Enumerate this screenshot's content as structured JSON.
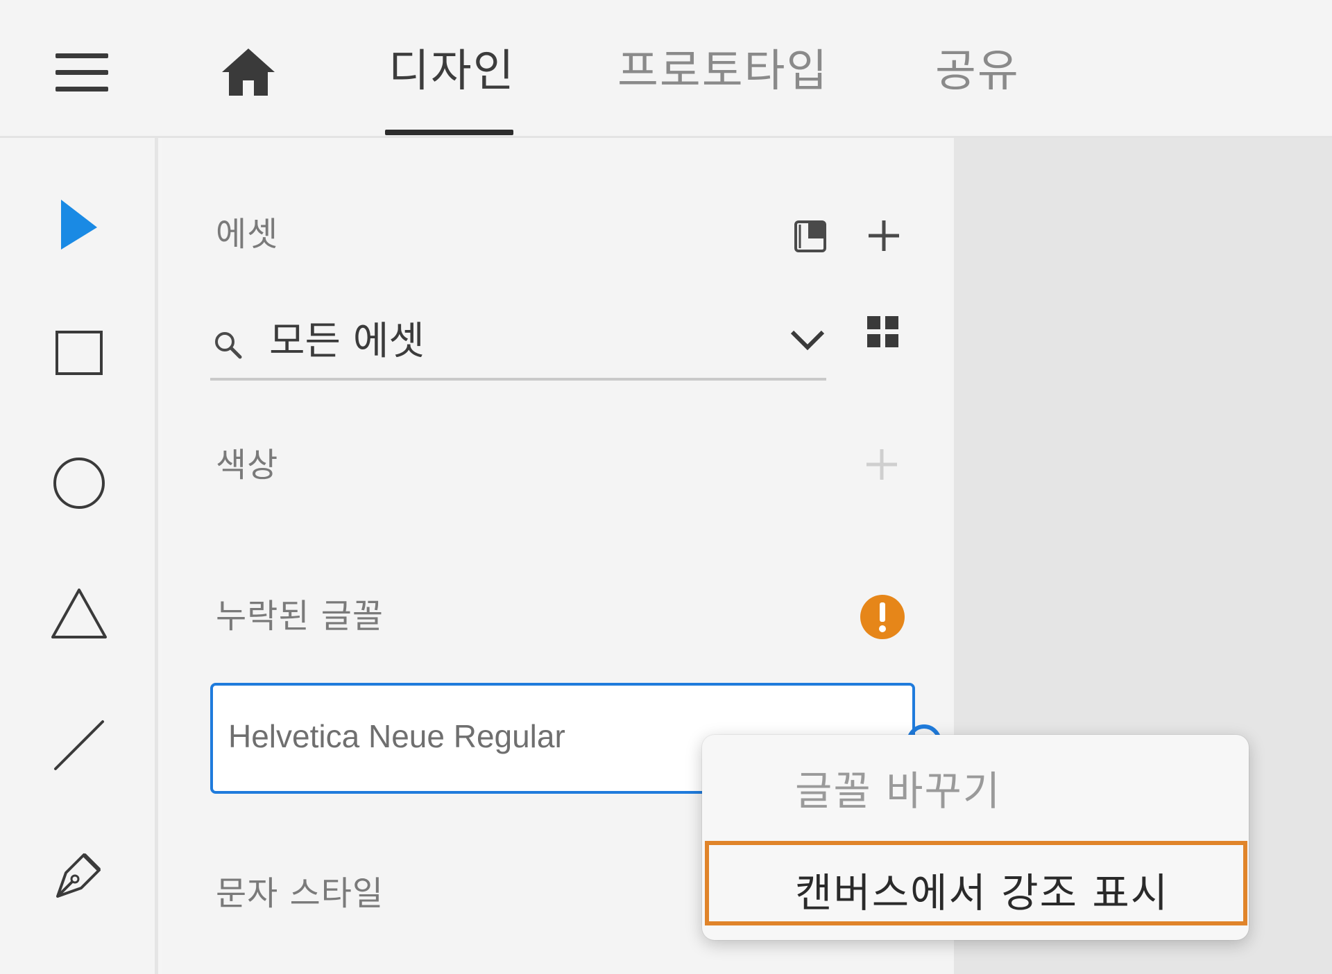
{
  "topbar": {
    "tabs": [
      {
        "label": "디자인",
        "active": true
      },
      {
        "label": "프로토타입",
        "active": false
      },
      {
        "label": "공유",
        "active": false
      }
    ]
  },
  "toolbar": {
    "tools": [
      "select-tool",
      "rectangle-tool",
      "ellipse-tool",
      "triangle-tool",
      "line-tool",
      "pen-tool"
    ],
    "active_color": "#1a8ae4"
  },
  "assets": {
    "title": "에셋",
    "search": {
      "value": "모든 에셋"
    },
    "colors": {
      "title": "색상"
    },
    "missing_fonts": {
      "title": "누락된 글꼴",
      "warning_color": "#e68619",
      "font_name": "Helvetica Neue Regular"
    },
    "char_styles": {
      "title": "문자 스타일"
    }
  },
  "context_menu": {
    "items": [
      {
        "label": "글꼴 바꾸기",
        "enabled": false
      },
      {
        "label": "캔버스에서 강조 표시",
        "enabled": true,
        "highlighted": true
      }
    ],
    "highlight_color": "#e0842a"
  }
}
